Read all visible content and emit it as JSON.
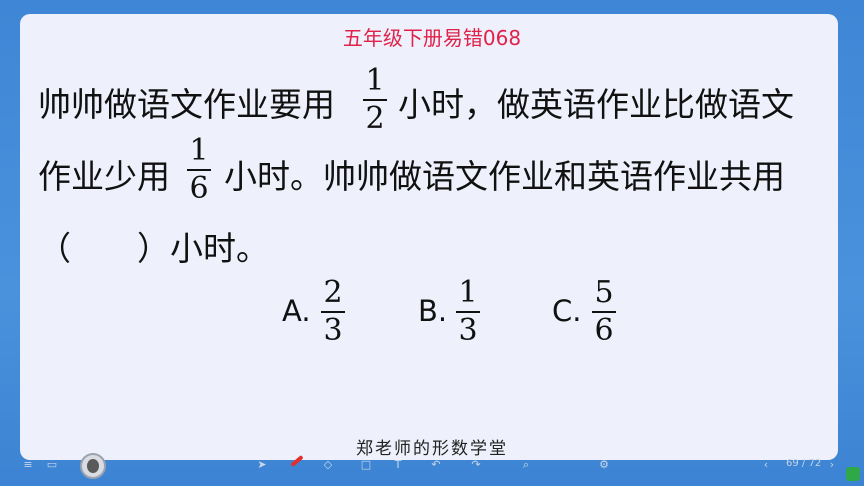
{
  "slide": {
    "title": "五年级下册易错068",
    "question": {
      "line1_a": "帅帅做语文作业要用",
      "frac1": {
        "num": "1",
        "den": "2"
      },
      "line1_b": "小时，做英语作业比做语文",
      "line2_a": "作业少用",
      "frac2": {
        "num": "1",
        "den": "6"
      },
      "line2_b": "小时。帅帅做语文作业和英语作业共用",
      "line3": "（　　）小时。"
    },
    "options": [
      {
        "letter": "A.",
        "num": "2",
        "den": "3"
      },
      {
        "letter": "B.",
        "num": "1",
        "den": "3"
      },
      {
        "letter": "C.",
        "num": "5",
        "den": "6"
      }
    ],
    "footer": "郑老师的形数学堂"
  },
  "toolbar": {
    "page_indicator": "69 / 72",
    "icons": [
      "menu-icon",
      "slides-icon",
      "avatar",
      "pointer-icon",
      "pen-icon",
      "eraser-icon",
      "shape-icon",
      "text-icon",
      "undo-icon",
      "redo-icon",
      "zoom-icon",
      "settings-icon",
      "prev-icon",
      "next-icon"
    ]
  },
  "colors": {
    "title": "#e0224a",
    "background": "#4a90d9",
    "slide": "#eef1fb"
  }
}
